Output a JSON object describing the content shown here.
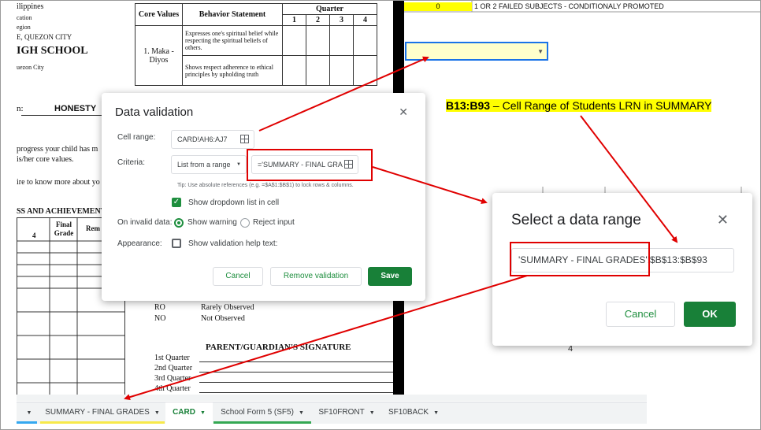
{
  "left_sheet": {
    "header_lines": [
      "ilippines",
      "cation",
      "egion",
      "E, QUEZON CITY"
    ],
    "school": "IGH SCHOOL",
    "city": "uezon City",
    "value_label": "n:",
    "value_name": "HONESTY",
    "body_lines": [
      "progress your child has m",
      "is/her core values.",
      "ire to know more about yo"
    ],
    "section_title": "SS AND ACHIEVEMENT",
    "grid_headers": [
      "4",
      "Final Grade",
      "Rem"
    ],
    "table": {
      "col_core_values": "Core Values",
      "col_behavior": "Behavior Statement",
      "col_quarter": "Quarter",
      "quarters": [
        "1",
        "2",
        "3",
        "4"
      ],
      "core_value_1": "1. Maka -Diyos",
      "statement_1": "Expresses one's spiritual belief while respecting the spiritual beliefs of others.",
      "statement_2": "Shows respect adherence to ethical principles by upholding truth"
    },
    "legend": [
      {
        "code": "RO",
        "text": "Rarely Observed"
      },
      {
        "code": "NO",
        "text": "Not Observed"
      }
    ],
    "signature_title": "PARENT/GUARDIAN'S SIGNATURE",
    "signature_rows": [
      "1st Quarter",
      "2nd Quarter",
      "3rd Quarter",
      "4th Quarter"
    ]
  },
  "right_sheet": {
    "yellow_cell_value": "0",
    "legend_text": "1 OR 2 FAILED SUBJECTS - CONDITIONALY PROMOTED",
    "cell_digit": "4"
  },
  "annotation": {
    "range": "B13:B93",
    "description": " – Cell Range of Students LRN in SUMMARY"
  },
  "data_validation": {
    "title": "Data validation",
    "cell_range_label": "Cell range:",
    "cell_range_value": "CARD!AH6:AJ7",
    "criteria_label": "Criteria:",
    "criteria_type": "List from a range",
    "criteria_value": "='SUMMARY - FINAL GRA",
    "tip": "Tip: Use absolute references (e.g. =$A$1:$B$1) to lock rows & columns.",
    "show_dropdown_label": "Show dropdown list in cell",
    "invalid_label": "On invalid data:",
    "show_warning_label": "Show warning",
    "reject_label": "Reject input",
    "appearance_label": "Appearance:",
    "help_text_label": "Show validation help text:",
    "cancel": "Cancel",
    "remove": "Remove validation",
    "save": "Save"
  },
  "select_range": {
    "title": "Select a data range",
    "value": "'SUMMARY - FINAL GRADES'!$B$13:$B$93",
    "cancel": "Cancel",
    "ok": "OK"
  },
  "tabs": [
    {
      "label": "SUMMARY - FINAL GRADES",
      "color": "#f7e94a"
    },
    {
      "label": "CARD",
      "color": "#ffffff",
      "active": true
    },
    {
      "label": "School Form 5 (SF5)",
      "color": "#34a853"
    },
    {
      "label": "SF10FRONT",
      "color": ""
    },
    {
      "label": "SF10BACK",
      "color": ""
    }
  ],
  "colors": {
    "accent_green": "#188038",
    "annotation_red": "#e00000",
    "highlight_yellow": "#ffff00"
  }
}
